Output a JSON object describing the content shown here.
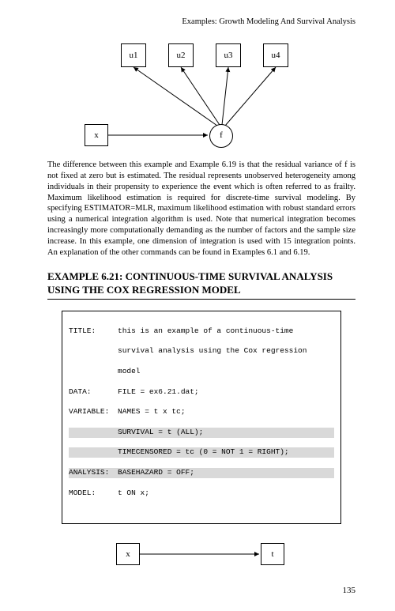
{
  "running_head": "Examples: Growth Modeling And Survival Analysis",
  "fig1": {
    "u1": "u1",
    "u2": "u2",
    "u3": "u3",
    "u4": "u4",
    "x": "x",
    "f": "f"
  },
  "paragraph": "The difference between this example and Example 6.19 is that the residual variance of f is not fixed at zero but is estimated. The residual represents unobserved heterogeneity among individuals in their propensity to experience the event which is often referred to as frailty. Maximum likelihood estimation is required for discrete-time survival modeling.  By specifying ESTIMATOR=MLR, maximum likelihood estimation with robust standard errors using a numerical integration algorithm is used.  Note that numerical integration becomes increasingly more computationally demanding as the number of factors and the sample size increase.  In this example, one dimension of integration is used with 15 integration points.  An explanation of the other commands can be found in Examples 6.1 and 6.19.",
  "section_title": "EXAMPLE 6.21: CONTINUOUS-TIME SURVIVAL ANALYSIS USING THE COX REGRESSION MODEL",
  "code": {
    "r1_label": "TITLE:",
    "r1_val": "this is an example of a continuous-time",
    "r2_val": "survival analysis using the Cox regression",
    "r3_val": "model",
    "r4_label": "DATA:",
    "r4_val": "FILE = ex6.21.dat;",
    "r5_label": "VARIABLE:",
    "r5_val": "NAMES = t x tc;",
    "r6_val": "SURVIVAL = t (ALL);",
    "r7_val": "TIMECENSORED = tc (0 = NOT 1 = RIGHT);",
    "r8_label": "ANALYSIS:",
    "r8_val": "BASEHAZARD = OFF;",
    "r9_label": "MODEL:",
    "r9_val": "t ON x;"
  },
  "fig2": {
    "x": "x",
    "t": "t"
  },
  "page_number": "135"
}
